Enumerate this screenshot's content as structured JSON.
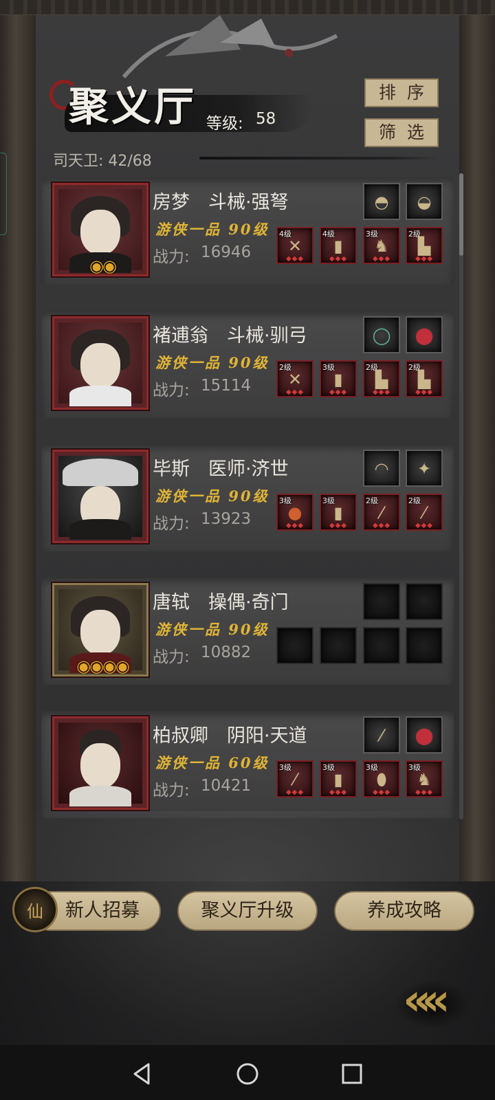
{
  "header": {
    "title": "聚义厅",
    "level_label": "等级:",
    "level_value": "58",
    "guards_text": "司天卫: 42/68",
    "sort_label": "排序",
    "filter_label": "筛选"
  },
  "heroes": [
    {
      "name": "房梦　斗械·强弩",
      "rank": "游侠一品 90级",
      "power_label": "战力:",
      "power": "16946",
      "stars": "◉◉",
      "frame": "red",
      "equip_levels": [
        "4级",
        "4级",
        "3级",
        "2级"
      ]
    },
    {
      "name": "褚逋翁　斗械·驯弓",
      "rank": "游侠一品 90级",
      "power_label": "战力:",
      "power": "15114",
      "stars": "",
      "frame": "red",
      "equip_levels": [
        "2级",
        "3级",
        "2级",
        "2级"
      ]
    },
    {
      "name": "毕斯　医师·济世",
      "rank": "游侠一品 90级",
      "power_label": "战力:",
      "power": "13923",
      "stars": "",
      "frame": "red",
      "equip_levels": [
        "3级",
        "3级",
        "2级",
        "2级"
      ]
    },
    {
      "name": "唐轼　操偶·奇门",
      "rank": "游侠一品 90级",
      "power_label": "战力:",
      "power": "10882",
      "stars": "◉◉◉◉",
      "frame": "gold",
      "equip_levels": [
        "",
        "",
        "",
        ""
      ]
    },
    {
      "name": "柏叔卿　阴阳·天道",
      "rank": "游侠一品 60级",
      "power_label": "战力:",
      "power": "10421",
      "stars": "",
      "frame": "red",
      "equip_levels": [
        "3级",
        "3级",
        "3级",
        "3级"
      ]
    }
  ],
  "bottom": {
    "recruit_label": "新人招募",
    "upgrade_label": "聚义厅升级",
    "guide_label": "养成攻略",
    "recruit_badge_glyph": "仙"
  },
  "back": {
    "glyph": "«"
  },
  "colors": {
    "accent_gold": "#e0b436",
    "frame_red": "#8e2a2a",
    "button_tan": "#c8b795"
  },
  "icons": {
    "nav_back": "triangle-back-icon",
    "nav_home": "circle-home-icon",
    "nav_recent": "square-recent-icon"
  }
}
